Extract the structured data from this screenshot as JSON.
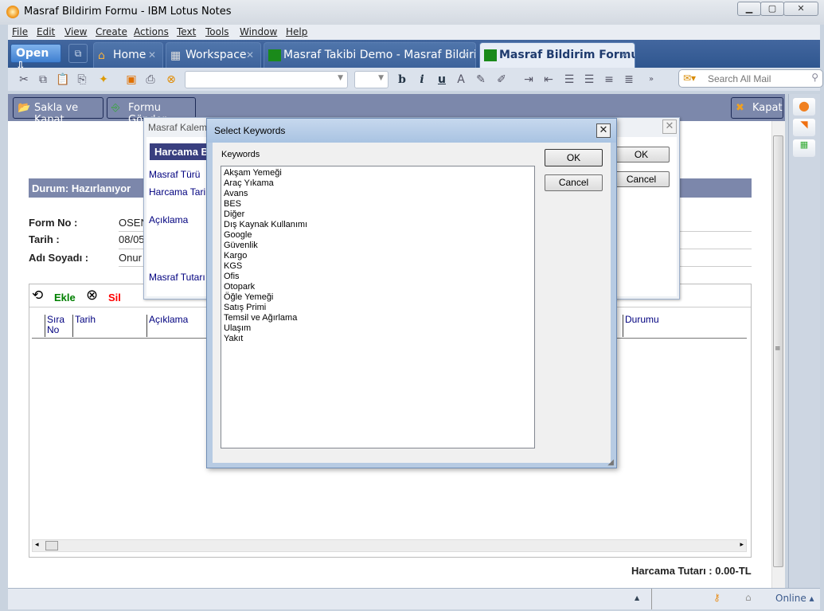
{
  "window": {
    "title": "Masraf Bildirim Formu - IBM Lotus Notes",
    "controls": [
      "minimize",
      "maximize",
      "close"
    ]
  },
  "menu": [
    "File",
    "Edit",
    "View",
    "Create",
    "Actions",
    "Text",
    "Tools",
    "Window",
    "Help"
  ],
  "tabs": {
    "open_label": "Open",
    "items": [
      {
        "label": "Home",
        "icon": "home-icon"
      },
      {
        "label": "Workspace",
        "icon": "workspace-icon"
      },
      {
        "label": "Masraf Takibi Demo - Masraf Bildiri...",
        "icon": "database-icon"
      },
      {
        "label": "Masraf Bildirim Formu",
        "icon": "form-icon",
        "active": true
      }
    ]
  },
  "toolbar": {
    "search_placeholder": "Search All Mail"
  },
  "actions": {
    "save_close": "Sakla ve Kapat",
    "send_form": "Formu Gönder",
    "close": "Kapat"
  },
  "form": {
    "status": "Durum: Hazırlanıyor",
    "fields": [
      {
        "label": "Form No :",
        "value": "OSEN"
      },
      {
        "label": "Tarih :",
        "value": "08/05"
      },
      {
        "label": "Adı Soyadı :",
        "value": "Onur"
      }
    ],
    "add_label": "Ekle",
    "delete_label": "Sil",
    "columns": [
      "Sıra No",
      "Tarih",
      "Açıklama",
      "Durumu"
    ],
    "total": "Harcama Tutarı : 0.00-TL"
  },
  "bg_dialog": {
    "title": "Masraf Kalem",
    "section": "Harcama B",
    "labels": [
      "Masraf Türü",
      "Harcama Tari",
      "Açıklama",
      "Masraf Tutarı"
    ],
    "ok": "OK",
    "cancel": "Cancel"
  },
  "dialog": {
    "title": "Select Keywords",
    "list_label": "Keywords",
    "ok": "OK",
    "cancel": "Cancel",
    "keywords": [
      "Akşam Yemeği",
      "Araç Yıkama",
      "Avans",
      "BES",
      "Diğer",
      "Dış Kaynak Kullanımı",
      "Google",
      "Güvenlik",
      "Kargo",
      "KGS",
      "Ofis",
      "Otopark",
      "Öğle Yemeği",
      "Satış Primi",
      "Temsil ve Ağırlama",
      "Ulaşım",
      "Yakıt"
    ]
  },
  "status": {
    "online": "Online"
  },
  "colors": {
    "tab_bar": "#3a5f96",
    "action_bar": "#7c88ab",
    "status_header": "#7c87ab",
    "add": "#008000",
    "delete": "#ff0000",
    "label_blue": "#00007f"
  }
}
